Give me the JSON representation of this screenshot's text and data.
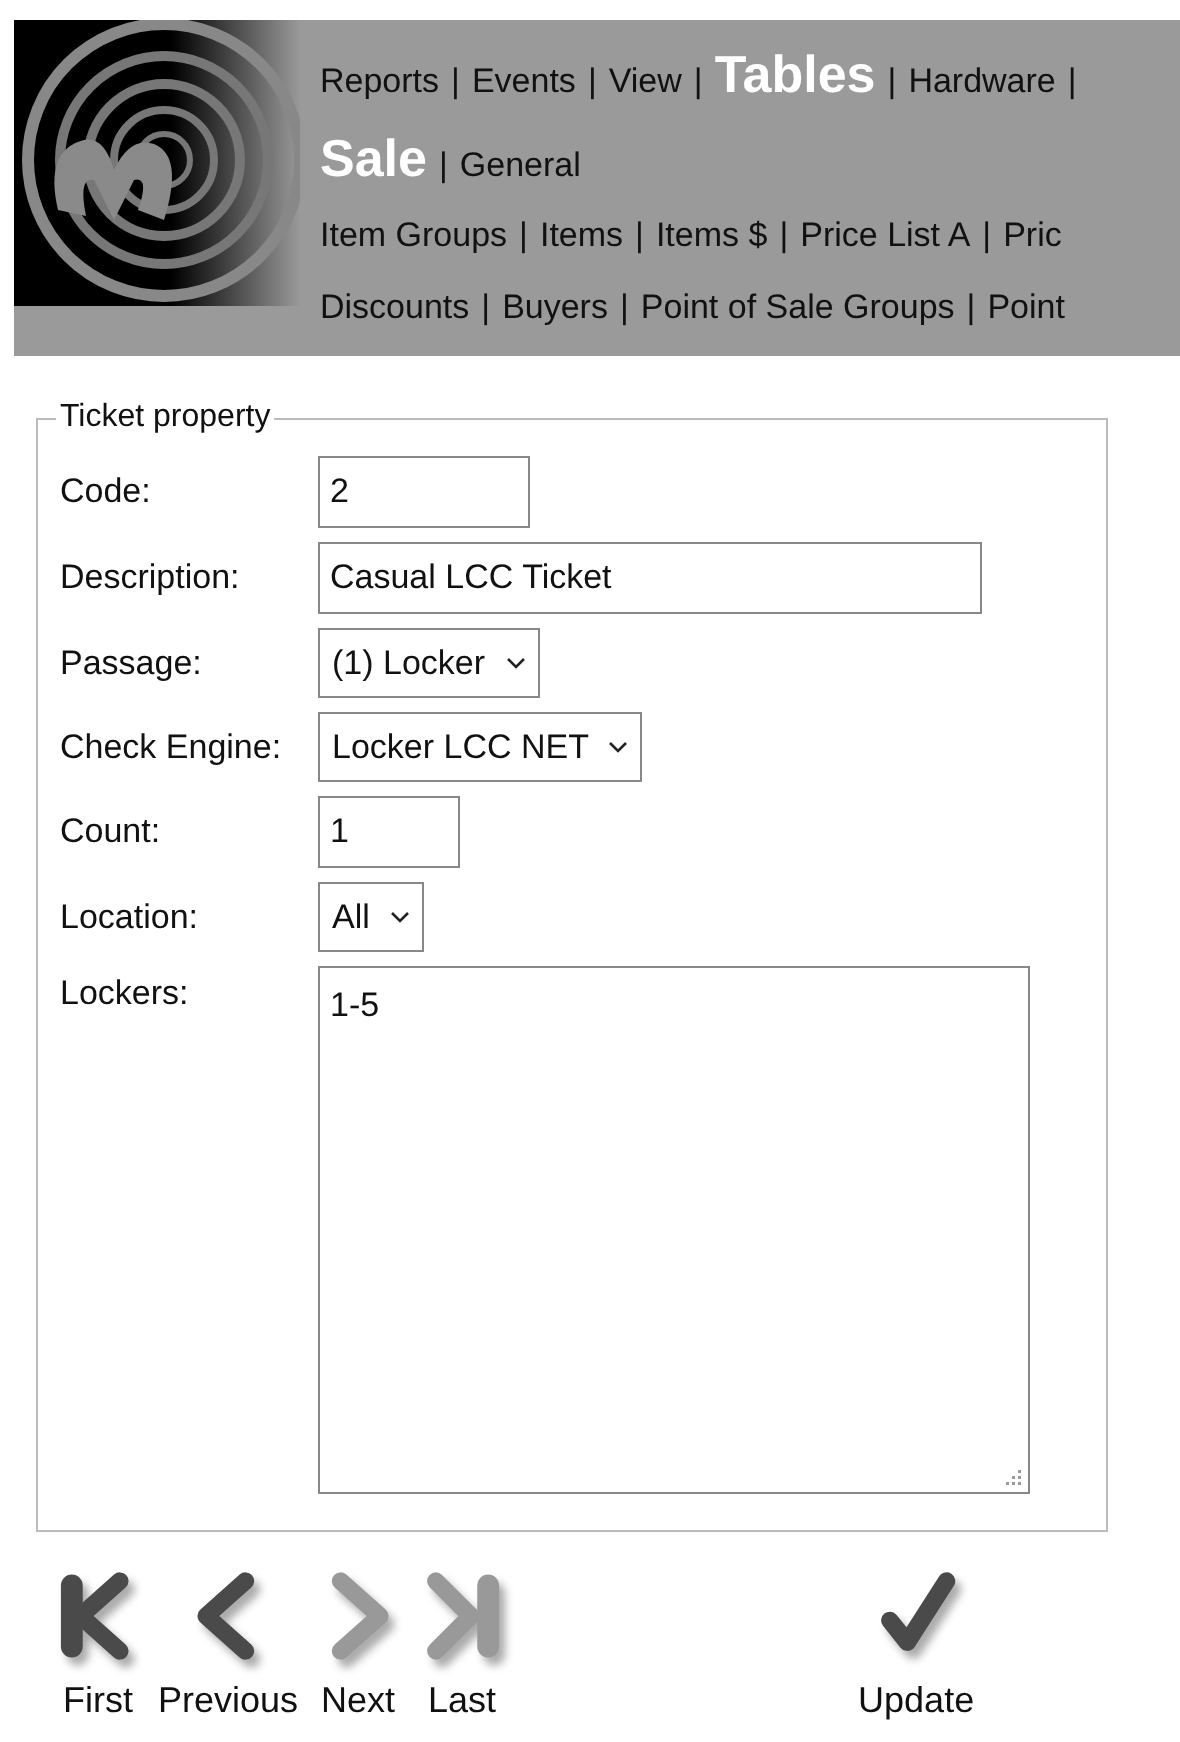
{
  "nav": {
    "separator": "|",
    "rows": [
      {
        "items": [
          {
            "label": "Reports",
            "selected": false
          },
          {
            "label": "Events",
            "selected": false
          },
          {
            "label": "View",
            "selected": false
          },
          {
            "label": "Tables",
            "selected": true
          },
          {
            "label": "Hardware",
            "selected": false
          }
        ],
        "trailing_separator": true
      },
      {
        "items": [
          {
            "label": "Sale",
            "selected": true
          },
          {
            "label": "General",
            "selected": false
          }
        ],
        "trailing_separator": false
      },
      {
        "items": [
          {
            "label": "Item Groups",
            "selected": false
          },
          {
            "label": "Items",
            "selected": false
          },
          {
            "label": "Items $",
            "selected": false
          },
          {
            "label": "Price List A",
            "selected": false
          },
          {
            "label": "Pric",
            "selected": false
          }
        ],
        "trailing_separator": false
      },
      {
        "items": [
          {
            "label": "Discounts",
            "selected": false
          },
          {
            "label": "Buyers",
            "selected": false
          },
          {
            "label": "Point of Sale Groups",
            "selected": false
          },
          {
            "label": "Point",
            "selected": false
          }
        ],
        "trailing_separator": false
      }
    ]
  },
  "form": {
    "title": "Ticket property",
    "fields": [
      {
        "label": "Code:",
        "kind": "text",
        "value": "2"
      },
      {
        "label": "Description:",
        "kind": "text",
        "value": "Casual LCC Ticket"
      },
      {
        "label": "Passage:",
        "kind": "select",
        "value": "(1) Locker"
      },
      {
        "label": "Check Engine:",
        "kind": "select",
        "value": "Locker LCC NET"
      },
      {
        "label": "Count:",
        "kind": "text",
        "value": "1"
      },
      {
        "label": "Location:",
        "kind": "select",
        "value": "All"
      },
      {
        "label": "Lockers:",
        "kind": "textarea",
        "value": "1-5"
      }
    ]
  },
  "buttons": [
    {
      "label": "First",
      "kind": "first",
      "disabled": false
    },
    {
      "label": "Previous",
      "kind": "previous",
      "disabled": false
    },
    {
      "label": "Next",
      "kind": "next",
      "disabled": true
    },
    {
      "label": "Last",
      "kind": "last",
      "disabled": true
    },
    {
      "label": "Update",
      "kind": "update",
      "disabled": false
    }
  ]
}
